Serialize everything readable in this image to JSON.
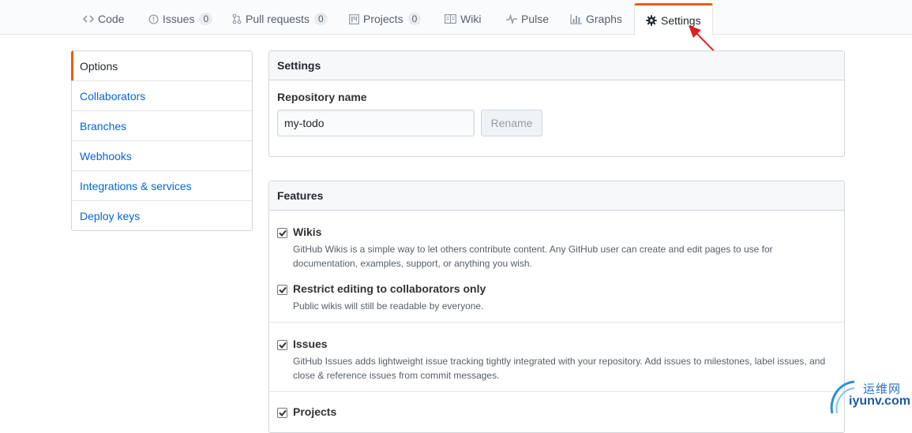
{
  "reponav": {
    "tabs": [
      {
        "label": "Code",
        "icon": "code-icon"
      },
      {
        "label": "Issues",
        "count": "0",
        "icon": "issue-opened-icon"
      },
      {
        "label": "Pull requests",
        "count": "0",
        "icon": "git-pull-request-icon"
      },
      {
        "label": "Projects",
        "count": "0",
        "icon": "project-icon"
      },
      {
        "label": "Wiki",
        "icon": "book-icon"
      },
      {
        "label": "Pulse",
        "icon": "pulse-icon"
      },
      {
        "label": "Graphs",
        "icon": "graph-icon"
      },
      {
        "label": "Settings",
        "icon": "gear-icon",
        "selected": true
      }
    ]
  },
  "menu": {
    "items": [
      {
        "label": "Options",
        "selected": true
      },
      {
        "label": "Collaborators"
      },
      {
        "label": "Branches"
      },
      {
        "label": "Webhooks"
      },
      {
        "label": "Integrations & services"
      },
      {
        "label": "Deploy keys"
      }
    ]
  },
  "settings": {
    "header": "Settings",
    "repo_name_label": "Repository name",
    "repo_name_value": "my-todo",
    "rename_label": "Rename"
  },
  "features": {
    "header": "Features",
    "items": [
      {
        "title": "Wikis",
        "checked": true,
        "desc": "GitHub Wikis is a simple way to let others contribute content. Any GitHub user can create and edit pages to use for documentation, examples, support, or anything you wish."
      },
      {
        "title": "Restrict editing to collaborators only",
        "checked": true,
        "desc": "Public wikis will still be readable by everyone."
      },
      {
        "title": "Issues",
        "checked": true,
        "desc": "GitHub Issues adds lightweight issue tracking tightly integrated with your repository. Add issues to milestones, label issues, and close & reference issues from commit messages."
      },
      {
        "title": "Projects",
        "checked": true,
        "desc": ""
      }
    ]
  },
  "watermark": {
    "cn": "运维网",
    "url": "iyunv.com"
  },
  "colors": {
    "accent_orange": "#e36209",
    "link_blue": "#0366d6",
    "annotation_red": "#e02020"
  }
}
